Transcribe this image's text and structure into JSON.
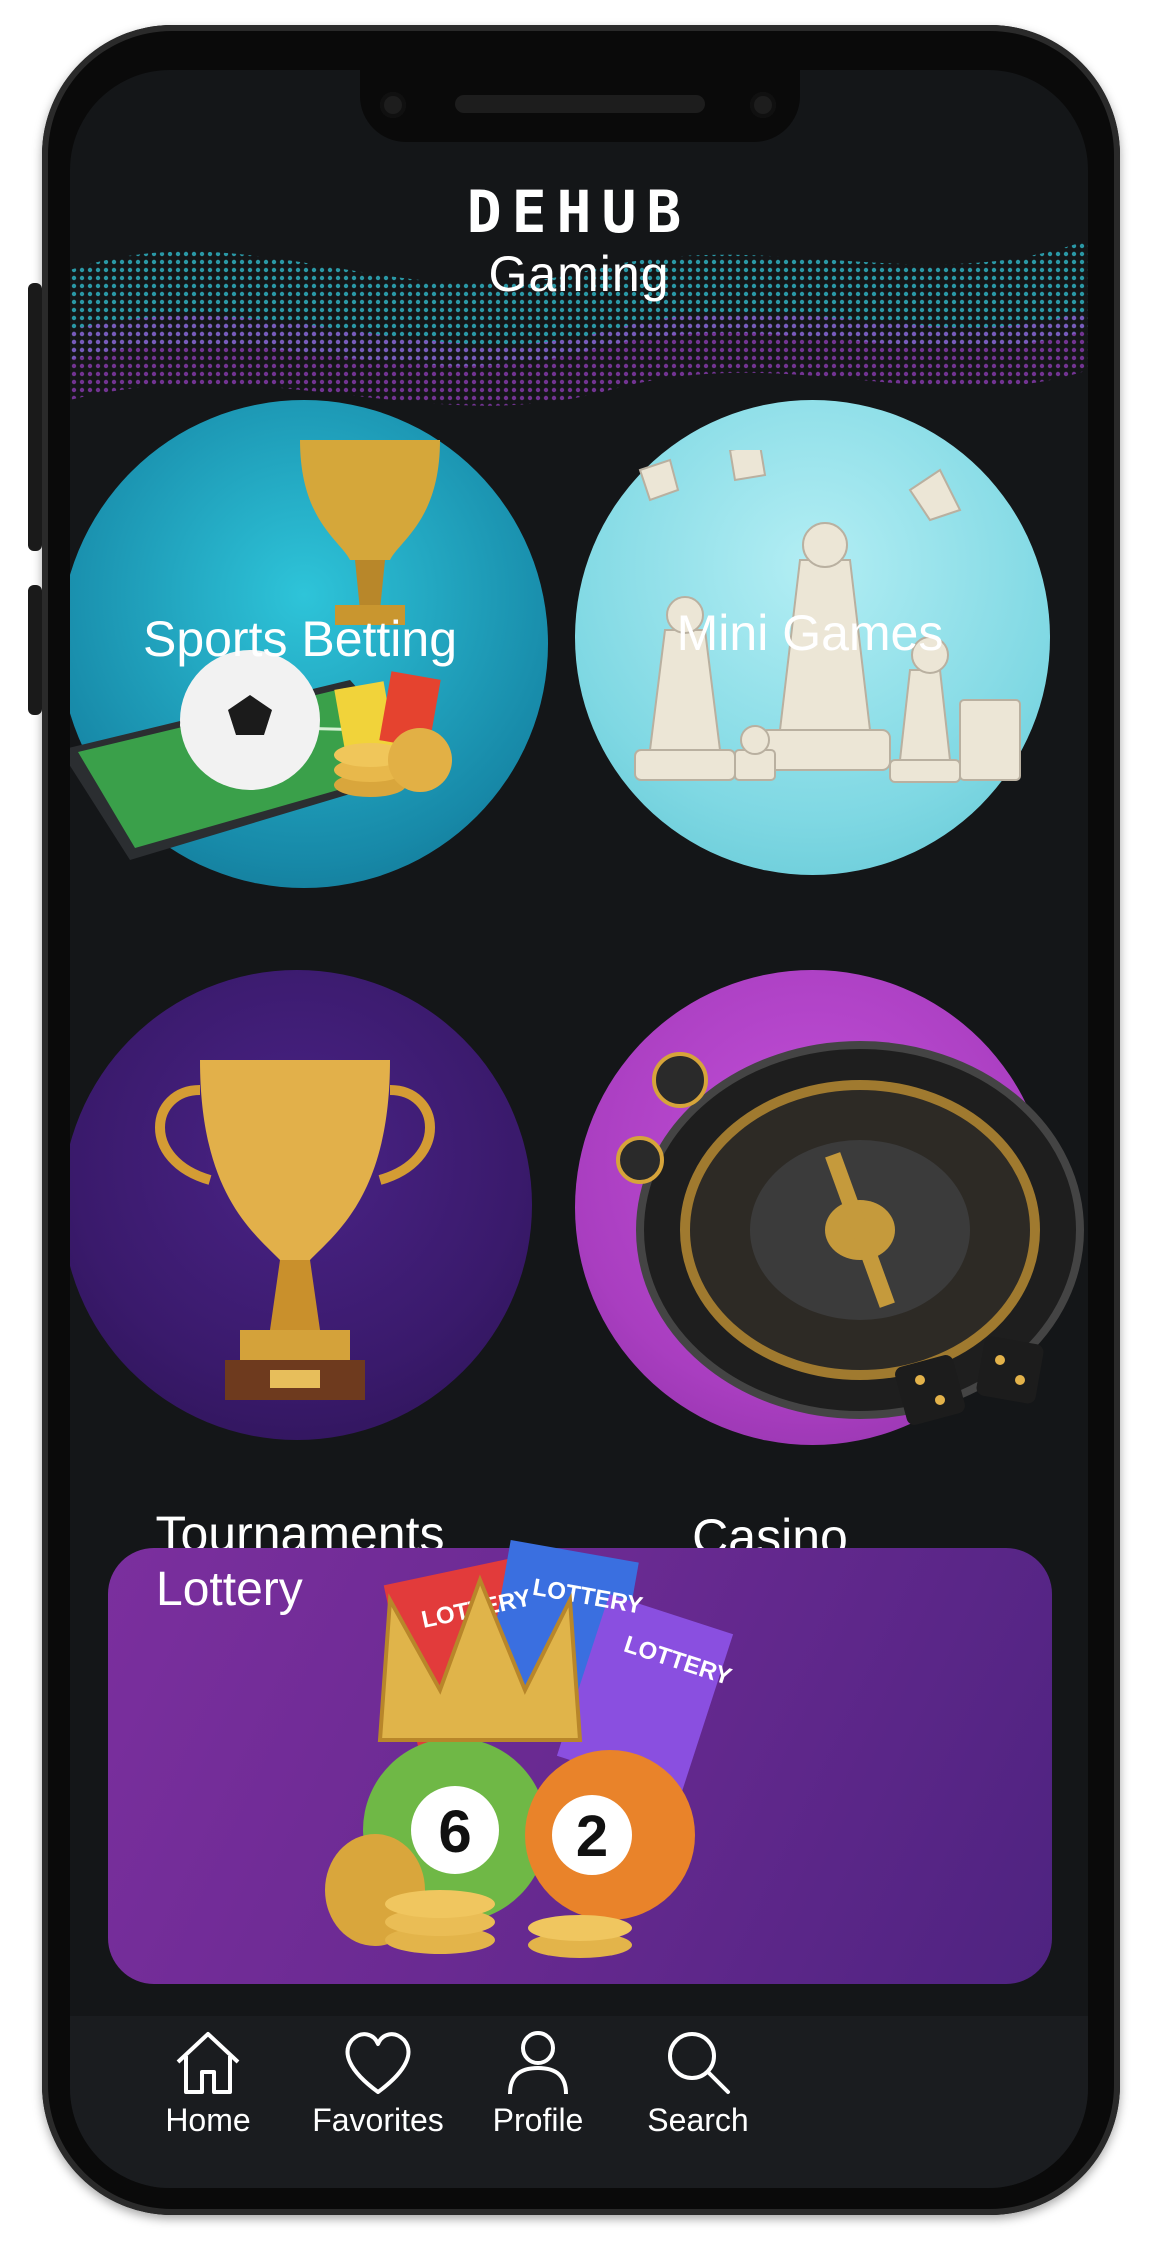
{
  "brand": {
    "logo": "DEHUB",
    "subtitle": "Gaming"
  },
  "tiles": [
    {
      "label": "Sports Betting",
      "color": "#1fa3c4"
    },
    {
      "label": "Mini Games",
      "color": "#8fe0ea"
    },
    {
      "label": "Tournaments",
      "color": "#3b1a6e"
    },
    {
      "label": "Casino",
      "color": "#b048c9"
    }
  ],
  "lottery": {
    "label": "Lottery",
    "tickets": [
      "LOTTERY",
      "LOTTERY",
      "LOTTERY"
    ],
    "balls": [
      "6",
      "2"
    ]
  },
  "nav": [
    {
      "label": "Home",
      "icon": "home-icon"
    },
    {
      "label": "Favorites",
      "icon": "heart-icon"
    },
    {
      "label": "Profile",
      "icon": "user-icon"
    },
    {
      "label": "Search",
      "icon": "search-icon"
    }
  ]
}
